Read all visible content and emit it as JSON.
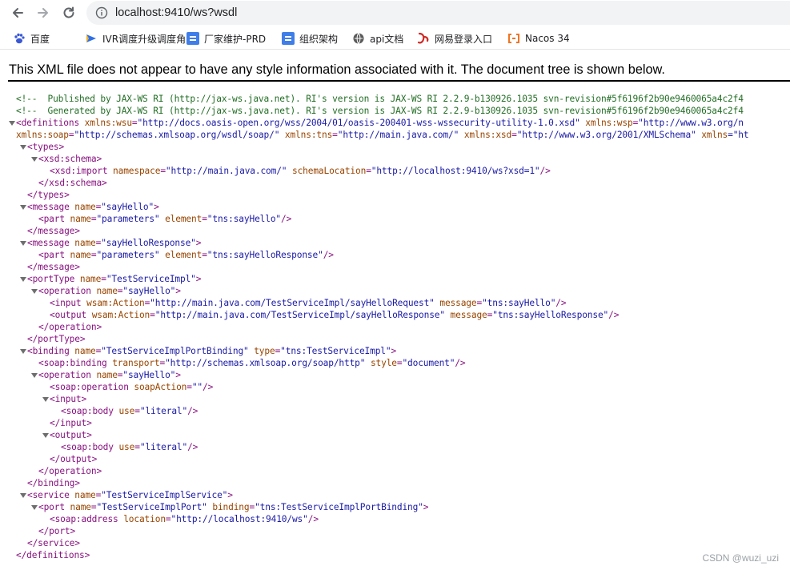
{
  "browser": {
    "url": "localhost:9410/ws?wsdl",
    "bookmarks": [
      {
        "label": "百度",
        "icon": "baidu-paw-icon"
      },
      {
        "label": "IVR调度升级调度角...",
        "icon": "bookmark-arrow-icon"
      },
      {
        "label": "厂家维护-PRD",
        "icon": "doc-icon"
      },
      {
        "label": "组织架构",
        "icon": "doc-icon"
      },
      {
        "label": "api文档",
        "icon": "globe-icon"
      },
      {
        "label": "网易登录入口",
        "icon": "netease-icon"
      },
      {
        "label": "Nacos 34",
        "icon": "nacos-icon"
      }
    ]
  },
  "xml": {
    "notice": "This XML file does not appear to have any style information associated with it. The document tree is shown below.",
    "comment1": "<!--  Published by JAX-WS RI (http://jax-ws.java.net). RI's version is JAX-WS RI 2.2.9-b130926.1035 svn-revision#5f6196f2b90e9460065a4c2f4",
    "comment2": "<!--  Generated by JAX-WS RI (http://jax-ws.java.net). RI's version is JAX-WS RI 2.2.9-b130926.1035 svn-revision#5f6196f2b90e9460065a4c2f4",
    "definitions": {
      "tag": "definitions",
      "attrs1": [
        {
          "name": "xmlns:wsu",
          "value": "\"http://docs.oasis-open.org/wss/2004/01/oasis-200401-wss-wssecurity-utility-1.0.xsd\""
        },
        {
          "name": "xmlns:wsp",
          "value": "\"http://www.w3.org/n"
        }
      ],
      "attrs2": [
        {
          "name": "xmlns:soap",
          "value": "\"http://schemas.xmlsoap.org/wsdl/soap/\""
        },
        {
          "name": "xmlns:tns",
          "value": "\"http://main.java.com/\""
        },
        {
          "name": "xmlns:xsd",
          "value": "\"http://www.w3.org/2001/XMLSchema\""
        },
        {
          "name": "xmlns",
          "value": "=\"ht"
        }
      ]
    },
    "types_tag": "types",
    "xsd_schema_tag": "xsd:schema",
    "xsd_import": {
      "tag": "xsd:import",
      "namespace": "\"http://main.java.com/\"",
      "schemaLocation": "\"http://localhost:9410/ws?xsd=1\""
    },
    "message1": {
      "name": "\"sayHello\"",
      "part_name": "\"parameters\"",
      "part_element": "\"tns:sayHello\""
    },
    "message2": {
      "name": "\"sayHelloResponse\"",
      "part_name": "\"parameters\"",
      "part_element": "\"tns:sayHelloResponse\""
    },
    "portType": {
      "name": "\"TestServiceImpl\"",
      "operation_name": "\"sayHello\"",
      "input_action": "\"http://main.java.com/TestServiceImpl/sayHelloRequest\"",
      "input_message": "\"tns:sayHello\"",
      "output_action": "\"http://main.java.com/TestServiceImpl/sayHelloResponse\"",
      "output_message": "\"tns:sayHelloResponse\""
    },
    "binding": {
      "name": "\"TestServiceImplPortBinding\"",
      "type": "\"tns:TestServiceImpl\"",
      "transport": "\"http://schemas.xmlsoap.org/soap/http\"",
      "style": "\"document\"",
      "operation_name": "\"sayHello\"",
      "soapAction": "\"\"",
      "use": "\"literal\""
    },
    "service": {
      "name": "\"TestServiceImplService\"",
      "port_name": "\"TestServiceImplPort\"",
      "port_binding": "\"tns:TestServiceImplPortBinding\"",
      "address_location": "\"http://localhost:9410/ws\""
    }
  },
  "watermark": "CSDN @wuzi_uzi"
}
